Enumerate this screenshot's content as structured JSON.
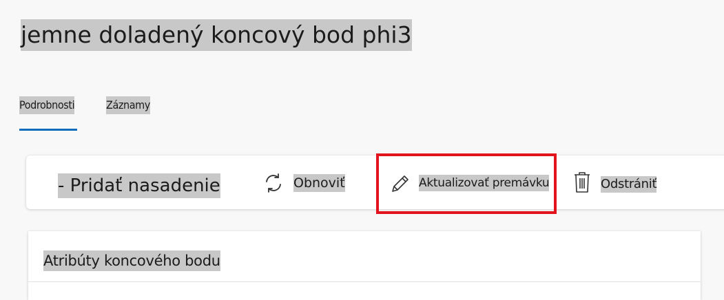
{
  "page": {
    "title": "jemne doladený koncový bod phi3"
  },
  "tabs": [
    {
      "label": "Podrobnosti",
      "active": true
    },
    {
      "label": "Záznamy",
      "active": false
    }
  ],
  "toolbar": {
    "add_deployment_label": "- Pridať nasadenie",
    "refresh_label": "Obnoviť",
    "refresh_icon": "refresh-icon",
    "update_traffic_label": "Aktualizovať premávku",
    "update_traffic_icon": "pencil-icon",
    "delete_label": "Odstrániť",
    "delete_icon": "trash-icon"
  },
  "card": {
    "title": "Atribúty koncového bodu"
  },
  "colors": {
    "accent": "#0f6cbd",
    "highlight": "#e3131e",
    "text_highlight": "#c8c8c8"
  }
}
